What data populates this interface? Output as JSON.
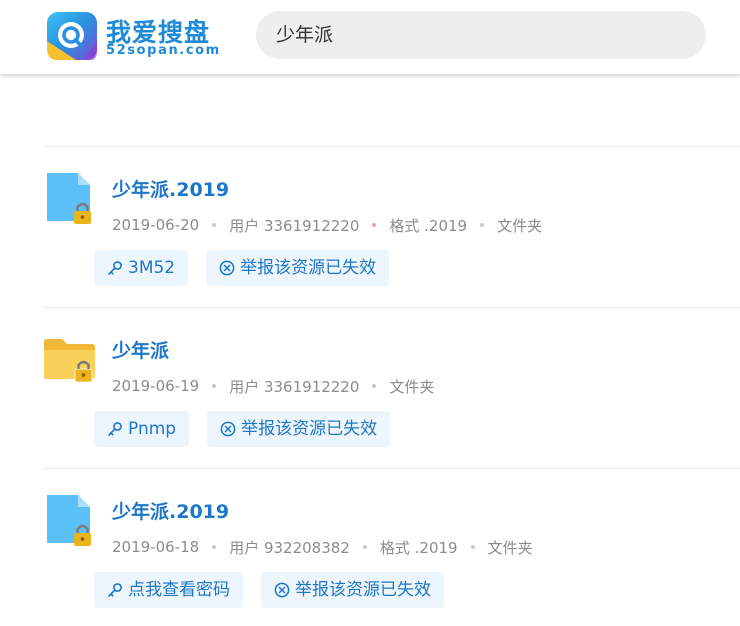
{
  "header": {
    "logo_cn": "我爱搜盘",
    "logo_en": "52sopan.com",
    "search_value": "少年派"
  },
  "colors": {
    "brand": "#1e8ad8",
    "title": "#1d77c9",
    "tag_bg": "#eef6fd",
    "file_blue": "#5bc0f8",
    "folder_yellow": "#f7c948",
    "lock": "#e9b51b"
  },
  "results": [
    {
      "icon": "file-lock-icon",
      "title": "少年派.2019",
      "date": "2019-06-20",
      "user": "用户 3361912220",
      "format": "格式 .2019",
      "type": "文件夹",
      "code_label": "3M52",
      "report_label": "举报该资源已失效"
    },
    {
      "icon": "folder-lock-icon",
      "title": "少年派",
      "date": "2019-06-19",
      "user": "用户 3361912220",
      "type": "文件夹",
      "code_label": "Pnmp",
      "report_label": "举报该资源已失效"
    },
    {
      "icon": "file-lock-icon",
      "title": "少年派.2019",
      "date": "2019-06-18",
      "user": "用户 932208382",
      "format": "格式 .2019",
      "type": "文件夹",
      "code_label": "点我查看密码",
      "report_label": "举报该资源已失效"
    }
  ]
}
